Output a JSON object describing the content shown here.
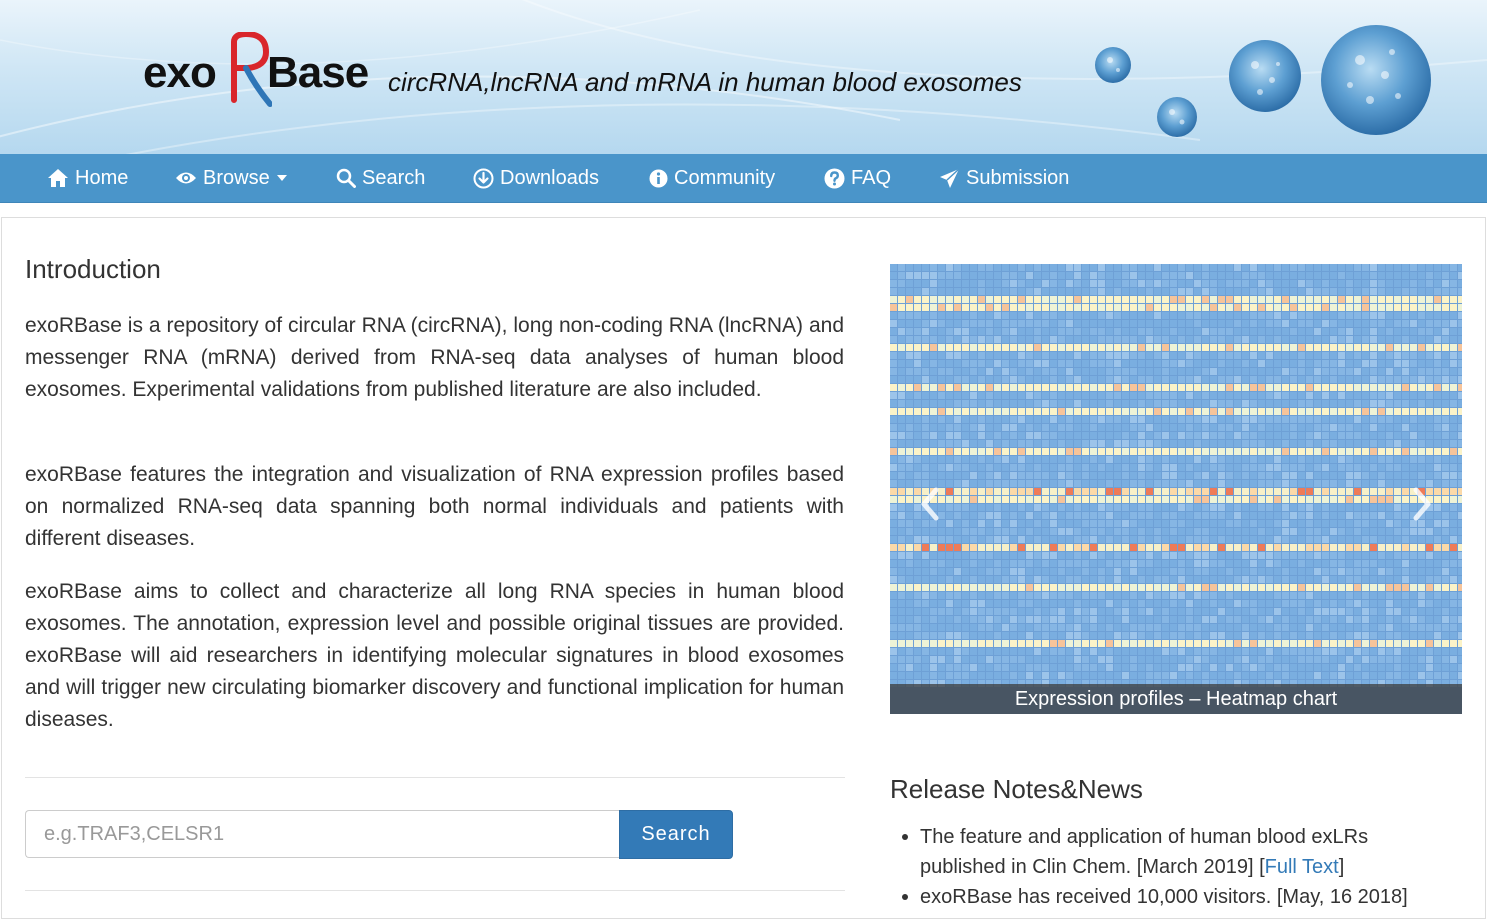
{
  "header": {
    "logo_left": "exo",
    "logo_r": "R",
    "logo_right": "Base",
    "tagline": "circRNA,lncRNA and mRNA in human blood exosomes"
  },
  "nav": [
    {
      "label": "Home",
      "icon": "home-icon"
    },
    {
      "label": "Browse",
      "icon": "eye-icon"
    },
    {
      "label": "Search",
      "icon": "search-icon"
    },
    {
      "label": "Downloads",
      "icon": "download-icon"
    },
    {
      "label": "Community",
      "icon": "info-icon"
    },
    {
      "label": "FAQ",
      "icon": "question-icon"
    },
    {
      "label": "Submission",
      "icon": "send-icon"
    }
  ],
  "intro": {
    "title": "Introduction",
    "paragraphs": [
      "exoRBase is a repository of circular RNA (circRNA), long non-coding RNA (lncRNA) and messenger RNA (mRNA) derived from RNA-seq data analyses of human blood exosomes. Experimental validations from published literature are also included.",
      "exoRBase features the integration and visualization of RNA expression profiles based on normalized RNA-seq data spanning both normal individuals and patients with different diseases.",
      "exoRBase aims to collect and characterize all long RNA species in human blood exosomes. The annotation, expression level and possible original tissues are provided. exoRBase will aid researchers in identifying molecular signatures in blood exosomes and will trigger new circulating biomarker discovery and functional implication for human diseases."
    ]
  },
  "search": {
    "placeholder": "e.g.TRAF3,CELSR1",
    "value": "",
    "button_label": "Search"
  },
  "carousel": {
    "caption": "Expression profiles – Heatmap chart",
    "prev_icon": "chevron-left-icon",
    "next_icon": "chevron-right-icon"
  },
  "news": {
    "title": "Release Notes&News",
    "items": [
      {
        "text": "The feature and application of human blood exLRs published in Clin Chem. [March 2019] [",
        "link": "Full Text",
        "after": "]"
      },
      {
        "text": "exoRBase has received 10,000 visitors. [May, 16 2018]"
      }
    ]
  },
  "colors": {
    "nav_bg": "#4a95ca",
    "button_bg": "#337ab7",
    "link": "#337ab7",
    "logo_r": "#d9262b",
    "logo_r_tail": "#2f76b7"
  }
}
